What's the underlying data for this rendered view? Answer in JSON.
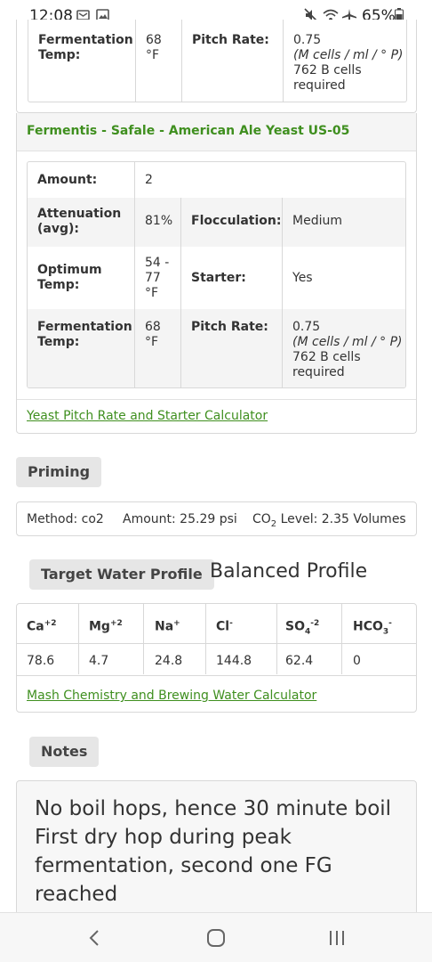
{
  "status_bar": {
    "time": "12:08",
    "battery": "65%"
  },
  "yeast_top": {
    "fermentation_temp_label": "Fermentation Temp:",
    "fermentation_temp_value": "68 °F",
    "pitch_rate_label": "Pitch Rate:",
    "pitch_rate_value": "0.75",
    "pitch_rate_unit": "(M cells / ml / ° P)",
    "cells_required": "762 B cells required"
  },
  "yeast": {
    "title": "Fermentis - Safale - American Ale Yeast US-05",
    "amount_label": "Amount:",
    "amount_value": "2",
    "attenuation_label": "Attenuation (avg):",
    "attenuation_value": "81%",
    "flocculation_label": "Flocculation:",
    "flocculation_value": "Medium",
    "optimum_temp_label": "Optimum Temp:",
    "optimum_temp_value": "54 - 77 °F",
    "starter_label": "Starter:",
    "starter_value": "Yes",
    "fermentation_temp_label": "Fermentation Temp:",
    "fermentation_temp_value": "68 °F",
    "pitch_rate_label": "Pitch Rate:",
    "pitch_rate_value": "0.75",
    "pitch_rate_unit": "(M cells / ml / ° P)",
    "cells_required": "762 B cells required",
    "calculator_link": "Yeast Pitch Rate and Starter Calculator"
  },
  "priming": {
    "title": "Priming",
    "method": "Method: co2",
    "amount": "Amount: 25.29 psi",
    "co2_prefix": "CO",
    "co2_sub": "2",
    "co2_suffix": " Level: 2.35 Volumes"
  },
  "water": {
    "title": "Target Water Profile",
    "profile_name": "Balanced Profile",
    "headers": [
      {
        "base": "Ca",
        "sup": "+2",
        "sub": "",
        "sub_sup": ""
      },
      {
        "base": "Mg",
        "sup": "+2",
        "sub": "",
        "sub_sup": ""
      },
      {
        "base": "Na",
        "sup": "+",
        "sub": "",
        "sub_sup": ""
      },
      {
        "base": "Cl",
        "sup": "-",
        "sub": "",
        "sub_sup": ""
      },
      {
        "base": "SO",
        "sup": "",
        "sub": "4",
        "sub_sup": "-2"
      },
      {
        "base": "HCO",
        "sup": "",
        "sub": "3",
        "sub_sup": "-"
      }
    ],
    "values": [
      "78.6",
      "4.7",
      "24.8",
      "144.8",
      "62.4",
      "0"
    ],
    "calculator_link": "Mash Chemistry and Brewing Water Calculator"
  },
  "notes": {
    "title": "Notes",
    "text": "No boil hops, hence 30 minute boil First dry hop during peak fermentation, second one FG reached"
  }
}
